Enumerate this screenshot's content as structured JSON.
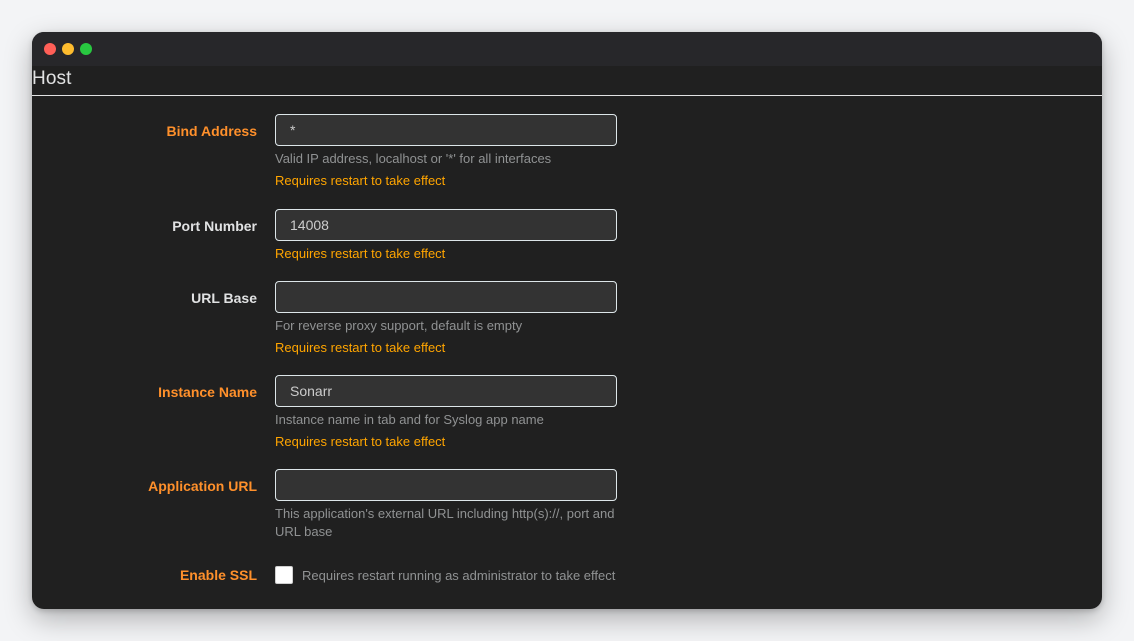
{
  "section": {
    "title": "Host"
  },
  "fields": {
    "bind_address": {
      "label": "Bind Address",
      "value": "*",
      "help": "Valid IP address, localhost or '*' for all interfaces",
      "warning": "Requires restart to take effect"
    },
    "port_number": {
      "label": "Port Number",
      "value": "14008",
      "warning": "Requires restart to take effect"
    },
    "url_base": {
      "label": "URL Base",
      "value": "",
      "help": "For reverse proxy support, default is empty",
      "warning": "Requires restart to take effect"
    },
    "instance_name": {
      "label": "Instance Name",
      "value": "Sonarr",
      "help": "Instance name in tab and for Syslog app name",
      "warning": "Requires restart to take effect"
    },
    "application_url": {
      "label": "Application URL",
      "value": "",
      "help_line1": "This application's external URL including http(s)://, port and",
      "help_line2": "URL base"
    },
    "enable_ssl": {
      "label": "Enable SSL",
      "checked": false,
      "help": "Requires restart running as administrator to take effect"
    }
  },
  "colors": {
    "background": "#202020",
    "advanced_label": "#ff902b",
    "warning": "#ffa500",
    "help_text": "#909293",
    "label": "#e1e2e3"
  }
}
